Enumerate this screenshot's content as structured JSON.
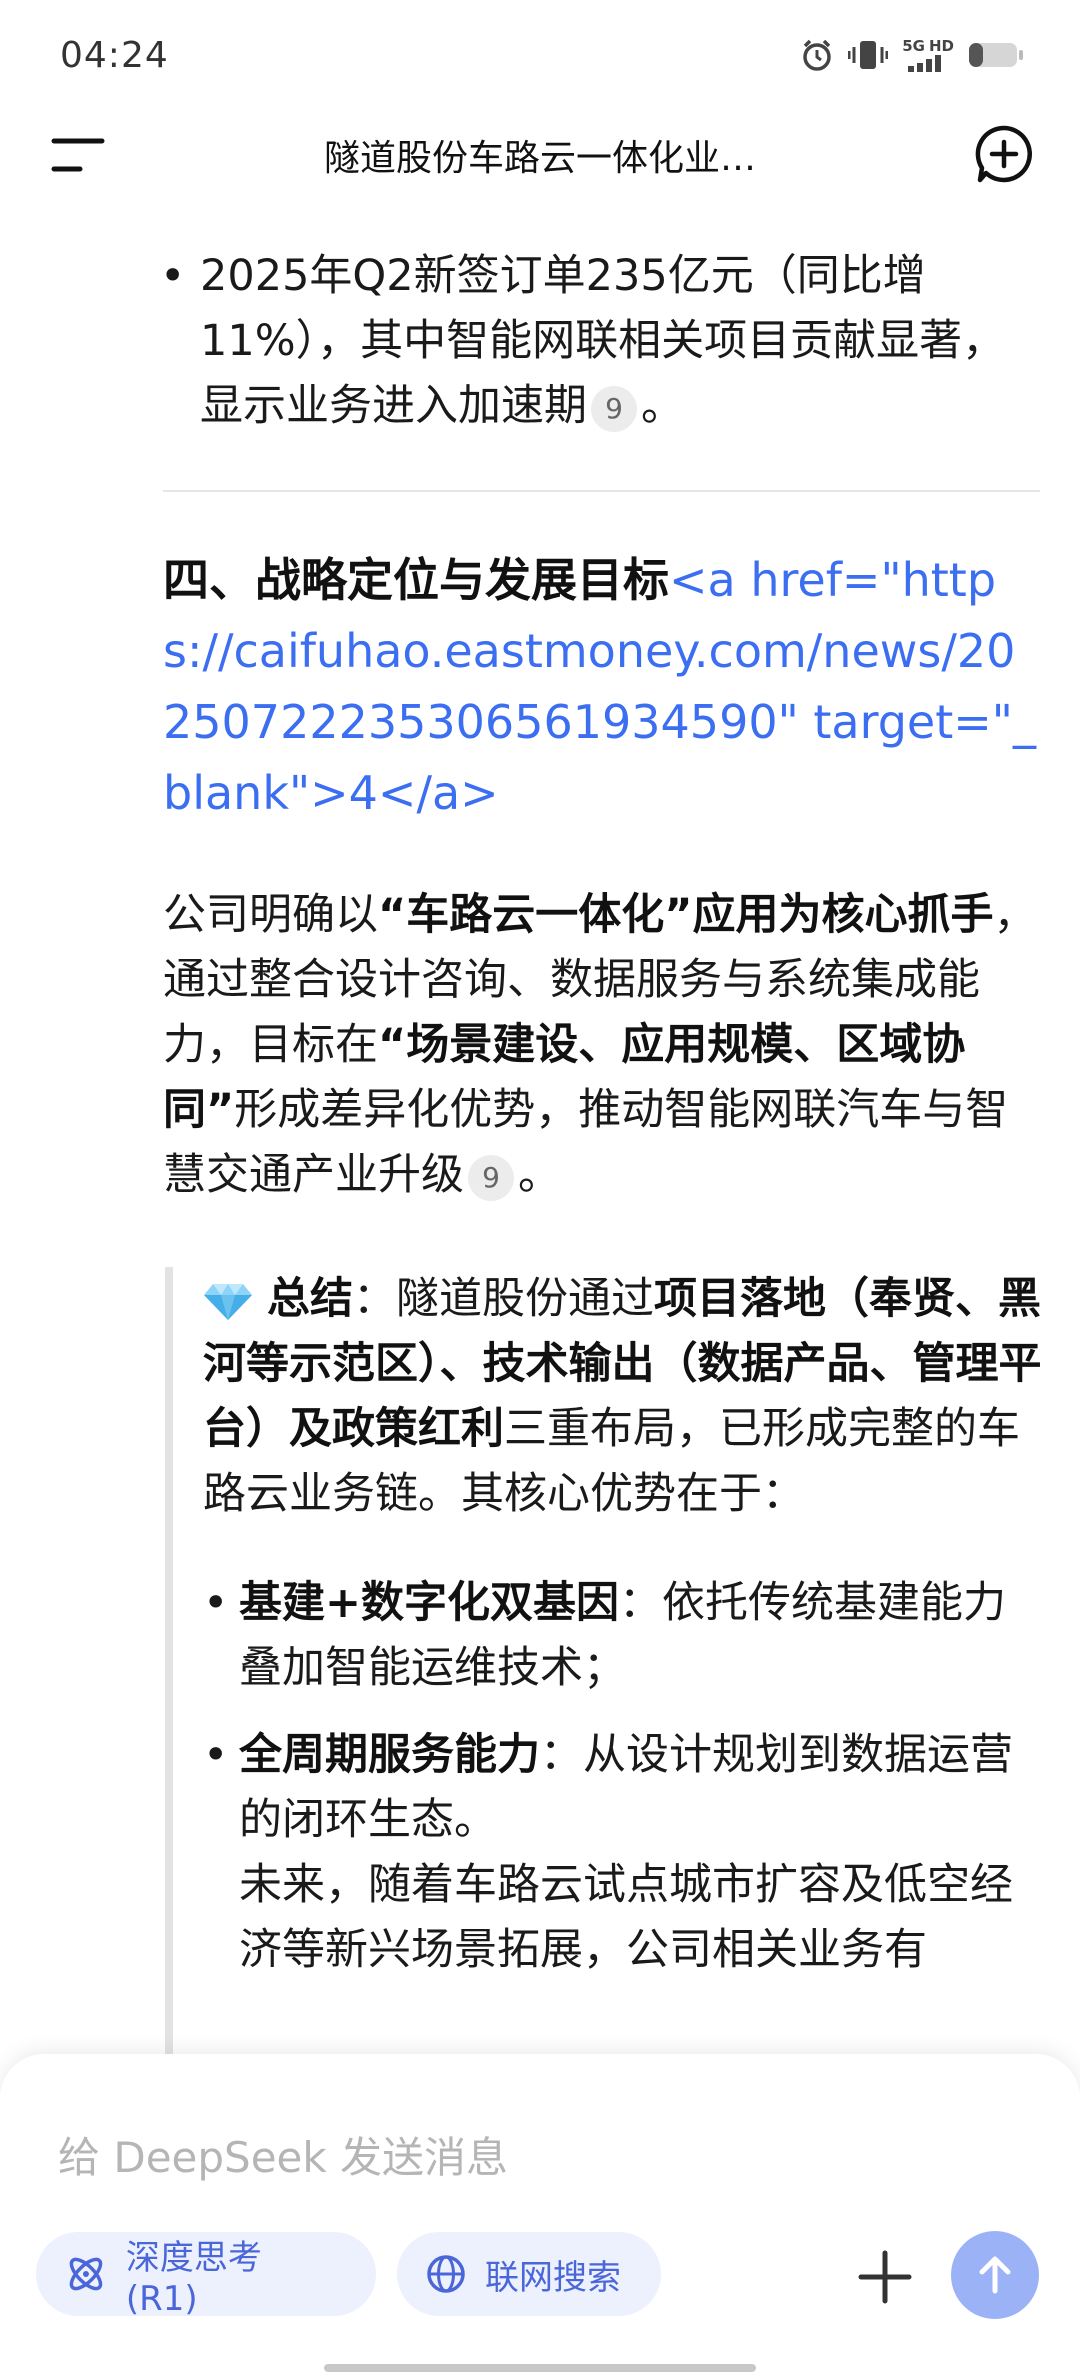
{
  "status": {
    "time": "04:24",
    "network": [
      "5G",
      "HD"
    ]
  },
  "header": {
    "title": "隧道股份车路云一体化业…",
    "menu_icon": "menu-icon",
    "new_chat_icon": "new-chat-icon"
  },
  "message": {
    "q2_bullet": {
      "text": "2025年Q2新签订单235亿元（同比增11%），其中智能网联相关项目贡献显著，显示业务进入加速期",
      "cite": "9",
      "end": "。"
    },
    "section": {
      "title": "四、战略定位与发展目标",
      "link_text": "<a href=\"https://caifuhao.eastmoney.com/news/20250722235306561934590\" target=\"_blank\">4</a>"
    },
    "para": {
      "p1": "公司明确以",
      "b1": "“车路云一体化”应用为核心抓手",
      "p2": "，通过整合设计咨询、数据服务与系统集成能力，目标在",
      "b2": "“场景建设、应用规模、区域协同”",
      "p3": "形成差异化优势，推动智能网联汽车与智慧交通产业升级",
      "cite": "9",
      "end": "。"
    },
    "summary": {
      "label": "总结",
      "t1": "：隧道股份通过",
      "b1": "项目落地（奉贤、黑河等示范区）、技术输出（数据产品、管理平台）及政策红利",
      "t2": "三重布局，已形成完整的车路云业务链。其核心优势在于："
    },
    "summary_bullets": [
      {
        "title": "基建+数字化双基因",
        "text": "：依托传统基建能力叠加智能运维技术；"
      },
      {
        "title": "全周期服务能力",
        "text": "：从设计规划到数据运营的闭环生态。"
      }
    ],
    "summary_tail": "未来，随着车路云试点城市扩容及低空经济等新兴场景拓展，公司相关业务有"
  },
  "input": {
    "placeholder": "给 DeepSeek 发送消息",
    "deep_think": "深度思考 (R1)",
    "web_search": "联网搜索"
  },
  "colors": {
    "accent": "#4a66d9",
    "link": "#3b6ef0",
    "chip_bg": "#edf1fd",
    "send_bg": "#9bb2f6"
  }
}
